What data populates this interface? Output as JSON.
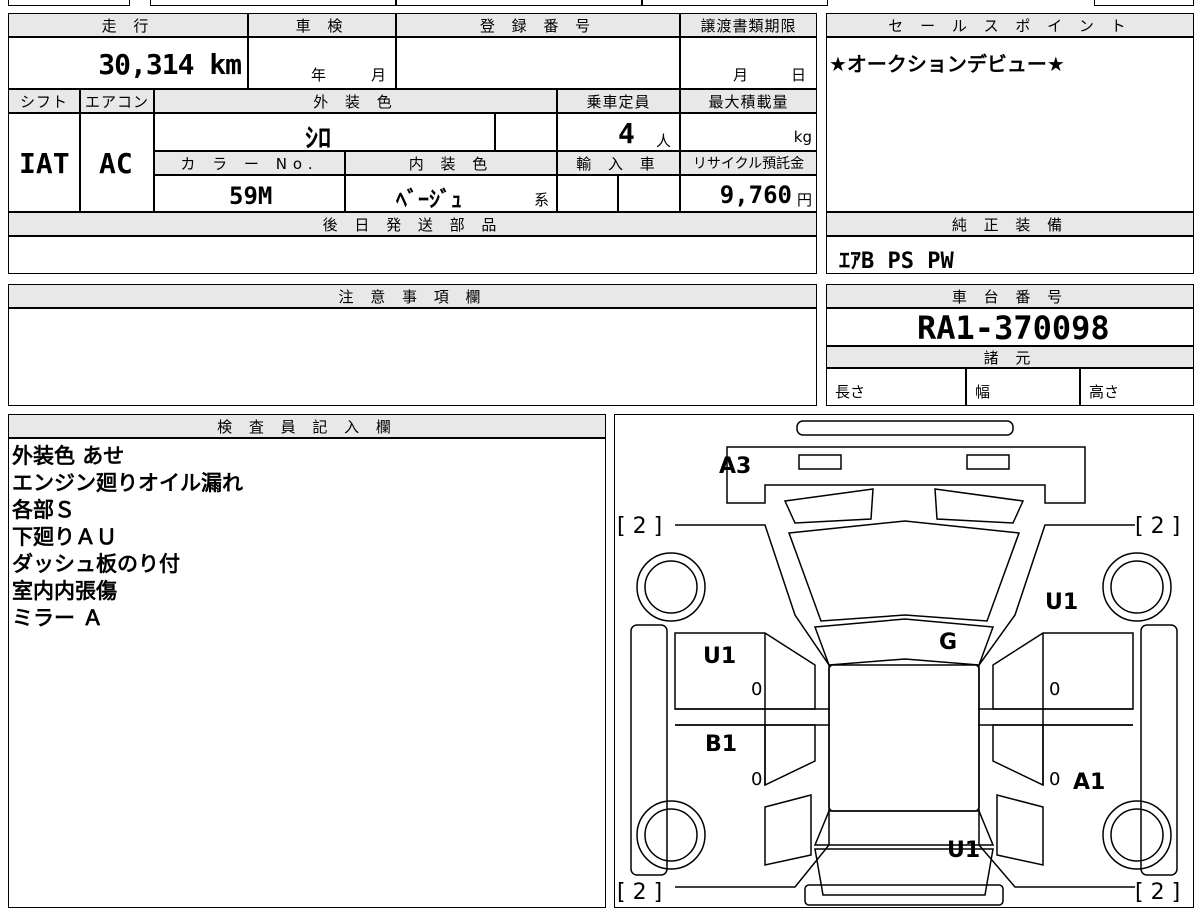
{
  "top_table": {
    "mileage_header": "走 行",
    "mileage_value": "30,314 km",
    "shaken_header": "車 検",
    "shaken_year": "年",
    "shaken_month": "月",
    "regno_header": "登 録 番 号",
    "transfer_header": "譲渡書類期限",
    "transfer_month": "月",
    "transfer_day": "日",
    "shift_header": "シフト",
    "shift_value": "IAT",
    "ac_header": "エアコン",
    "ac_value": "AC",
    "exterior_header": "外 装 色",
    "exterior_value": "ｼﾛ",
    "capacity_header": "乗車定員",
    "capacity_value": "4",
    "capacity_unit": "人",
    "maxload_header": "最大積載量",
    "maxload_unit": "kg",
    "colorno_header": "カ ラ ー No.",
    "colorno_value": "59M",
    "interior_header": "内 装 色",
    "interior_value": "ﾍﾞｰｼﾞｭ",
    "interior_suffix": "系",
    "import_header": "輸 入 車",
    "recycle_header": "リサイクル預託金",
    "recycle_value": "9,760",
    "recycle_unit": "円",
    "later_header": "後 日 発 送 部 品"
  },
  "sales_point": {
    "header": "セ ー ル ス ポ イ ン ト",
    "text": "★オークションデビュー★"
  },
  "genuine": {
    "header": "純 正 装 備",
    "text": "ｴｱB PS PW"
  },
  "caution": {
    "header": "注 意 事 項 欄"
  },
  "chassis": {
    "header": "車 台 番 号",
    "value": "RA1-370098",
    "spec_header": "諸 元",
    "length": "長さ",
    "width": "幅",
    "height": "高さ"
  },
  "inspector": {
    "header": "検 査 員 記 入 欄",
    "lines": [
      "外装色 あせ",
      "エンジン廻りオイル漏れ",
      "各部Ｓ",
      "下廻りＡＵ",
      "ダッシュ板のり付",
      "室内内張傷",
      "ミラー Ａ"
    ]
  },
  "diagram": {
    "codes": {
      "a3": "A3",
      "g": "G",
      "u1_left": "U1",
      "u1_right_top": "U1",
      "u1_right": "U1",
      "b1": "B1",
      "a1": "A1",
      "u1_bottom": "U1"
    },
    "tires": {
      "fl": "[ 2 ]",
      "fr": "[ 2 ]",
      "rl": "[ 2 ]",
      "rr": "[ 2 ]"
    },
    "zeros": {
      "z1": "0",
      "z2": "0",
      "z3": "0",
      "z4": "0"
    }
  }
}
